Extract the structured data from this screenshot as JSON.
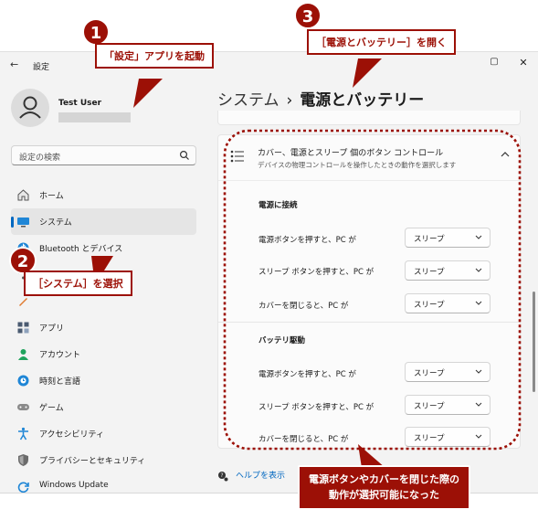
{
  "window": {
    "back_glyph": "←",
    "app_title": "設定",
    "controls": [
      "—",
      "▢",
      "✕"
    ]
  },
  "profile": {
    "name": "Test User"
  },
  "search": {
    "placeholder": "設定の検索"
  },
  "sidebar": {
    "items": [
      {
        "label": "ホーム",
        "icon": "home-icon"
      },
      {
        "label": "システム",
        "icon": "system-icon",
        "selected": true
      },
      {
        "label": "Bluetooth とデバイス",
        "icon": "bluetooth-icon"
      },
      {
        "label": "",
        "icon": "network-icon"
      },
      {
        "label": "",
        "icon": "personalization-icon"
      },
      {
        "label": "アプリ",
        "icon": "apps-icon"
      },
      {
        "label": "アカウント",
        "icon": "accounts-icon"
      },
      {
        "label": "時刻と言語",
        "icon": "time-language-icon"
      },
      {
        "label": "ゲーム",
        "icon": "gaming-icon"
      },
      {
        "label": "アクセシビリティ",
        "icon": "accessibility-icon"
      },
      {
        "label": "プライバシーとセキュリティ",
        "icon": "privacy-icon"
      },
      {
        "label": "Windows Update",
        "icon": "windows-update-icon"
      }
    ]
  },
  "header": {
    "breadcrumb": "システム",
    "separator": "›",
    "title": "電源とバッテリー"
  },
  "card": {
    "title": "カバー、電源とスリープ 個のボタン コントロール",
    "description": "デバイスの物理コントロールを操作したときの動作を選択します",
    "sections": [
      {
        "title": "電源に接続",
        "rows": [
          {
            "label": "電源ボタンを押すと、PC が",
            "value": "スリープ"
          },
          {
            "label": "スリープ ボタンを押すと、PC が",
            "value": "スリープ"
          },
          {
            "label": "カバーを閉じると、PC が",
            "value": "スリープ"
          }
        ]
      },
      {
        "title": "バッテリ駆動",
        "rows": [
          {
            "label": "電源ボタンを押すと、PC が",
            "value": "スリープ"
          },
          {
            "label": "スリープ ボタンを押すと、PC が",
            "value": "スリープ"
          },
          {
            "label": "カバーを閉じると、PC が",
            "value": "スリープ"
          }
        ]
      }
    ]
  },
  "help": {
    "label": "ヘルプを表示"
  },
  "annotations": {
    "step1": {
      "number": "1",
      "text": "「設定」アプリを起動"
    },
    "step2": {
      "number": "2",
      "text": "［システム］を選択"
    },
    "step3": {
      "number": "3",
      "text": "［電源とバッテリー］を開く"
    },
    "note": {
      "line1": "電源ボタンやカバーを閉じた際の",
      "line2": "動作が選択可能になった"
    }
  },
  "colors": {
    "accent": "#0067c0",
    "annotation": "#9c1006"
  }
}
